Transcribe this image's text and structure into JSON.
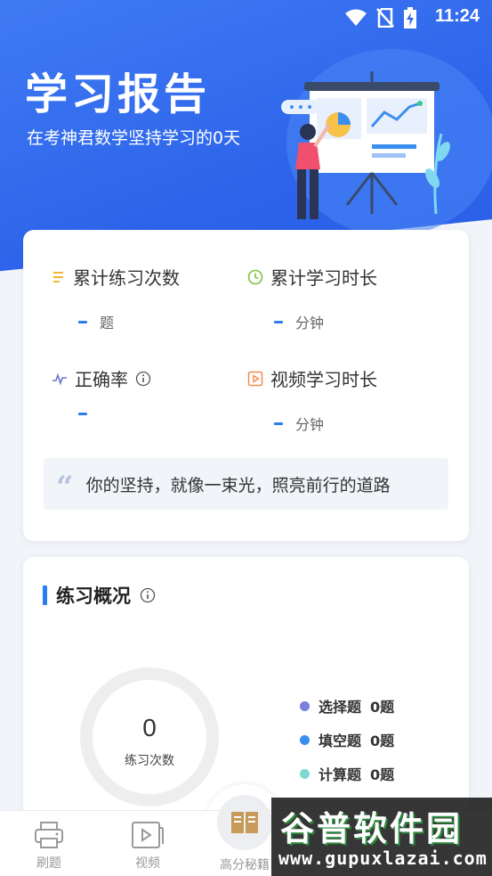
{
  "status_bar": {
    "time": "11:24"
  },
  "hero": {
    "title": "学习报告",
    "subtitle": "在考神君数学坚持学习的0天"
  },
  "stats": [
    {
      "label": "累计练习次数",
      "value": "-",
      "unit": "题",
      "icon": "list-icon",
      "icon_color": "#f2b632"
    },
    {
      "label": "累计学习时长",
      "value": "-",
      "unit": "分钟",
      "icon": "clock-icon",
      "icon_color": "#7cc242"
    },
    {
      "label": "正确率",
      "value": "-",
      "unit": "",
      "icon": "pulse-icon",
      "icon_color": "#6a78c8",
      "has_info": true
    },
    {
      "label": "视频学习时长",
      "value": "-",
      "unit": "分钟",
      "icon": "video-icon",
      "icon_color": "#f08a4b"
    }
  ],
  "quote": {
    "mark": "“",
    "text": "你的坚持，就像一束光，照亮前行的道路"
  },
  "practice": {
    "title": "练习概况",
    "total": "0",
    "total_label": "练习次数",
    "legend": [
      {
        "label": "选择题",
        "count": "0题",
        "color": "#7b7fe0"
      },
      {
        "label": "填空题",
        "count": "0题",
        "color": "#3a8ef0"
      },
      {
        "label": "计算题",
        "count": "0题",
        "color": "#7fd8cf"
      }
    ]
  },
  "tabbar": {
    "items": [
      {
        "label": "刷题",
        "icon": "printer-icon"
      },
      {
        "label": "视频",
        "icon": "video-play-icon"
      },
      {
        "label": "高分秘籍",
        "icon": "book-icon"
      }
    ]
  },
  "watermark": {
    "name": "谷普软件园",
    "url": "www.gupuxlazai.com"
  }
}
